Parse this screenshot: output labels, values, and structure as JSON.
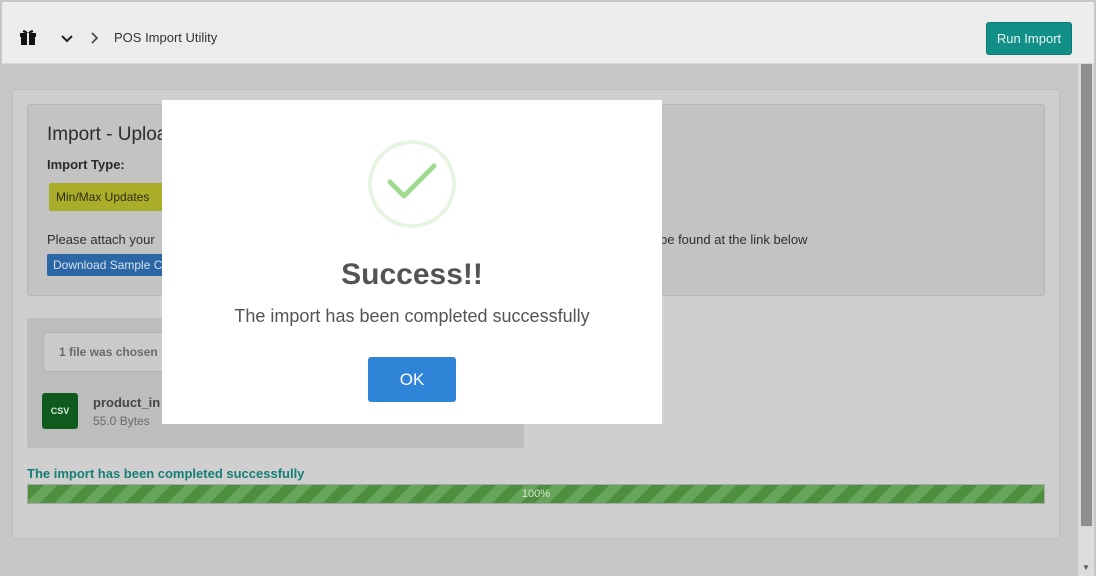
{
  "header": {
    "breadcrumb_title": "POS Import Utility",
    "run_import_label": "Run Import",
    "icons": [
      "gift-icon",
      "chevron-down-icon",
      "chevron-right-icon"
    ],
    "accent_color": "#17a398"
  },
  "import_panel": {
    "title": "Import - Uploa",
    "type_label": "Import Type:",
    "selected_type": "Min/Max Updates",
    "attach_text_start": "Please attach your",
    "attach_text_end": "be found at the link below",
    "download_label": "Download Sample C"
  },
  "upload": {
    "chosen_text": "1 file was chosen",
    "file_type_badge": "CSV",
    "file_name": "product_in",
    "file_size": "55.0 Bytes"
  },
  "status": {
    "message": "The import has been completed successfully",
    "progress_label": "100%",
    "progress_value": 1.0,
    "progress_color": "#5cb85c"
  },
  "modal": {
    "icon": "check-circle-icon",
    "title": "Success!!",
    "text": "The import has been completed successfully",
    "ok_label": "OK",
    "ok_color": "#3085d6"
  }
}
